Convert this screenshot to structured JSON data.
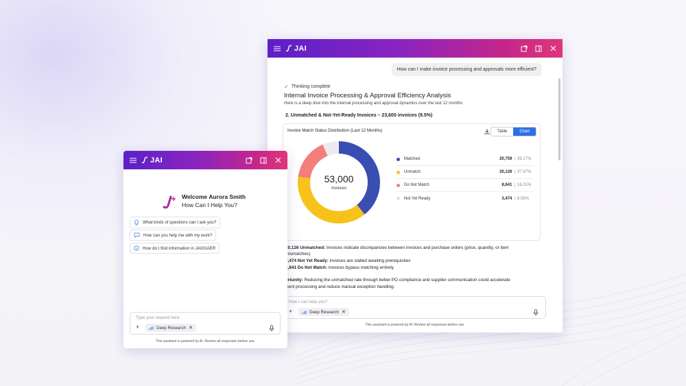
{
  "big_window": {
    "brand": "JAI",
    "user_message": "How can I make invoice processing and approvals more efficient?",
    "thinking_status": "Thinking complete",
    "title": "Internal Invoice Processing & Approval Efficiency Analysis",
    "subtitle": "Here is a deep dive into the internal processing and approval dynamics over the last 12 months",
    "section_heading": "2. Unmatched & Not-Yet-Ready Invoices – 23,600 invoices (9.5%)",
    "card": {
      "title": "Invoice Match Status Distribution (Last 12 Months)",
      "toggle_table": "Table",
      "toggle_chart": "Chart"
    },
    "bullets": [
      {
        "bold": "20,126 Unmatched:",
        "text": " Invoices indicate discrepancies between invoices and purchase orders (price, quantity, or item"
      },
      {
        "bold": "",
        "text": "mismatches)"
      },
      {
        "bold": "3,474 Not Yet Ready:",
        "text": " invoices are stalled awaiting prerequisites"
      },
      {
        "bold": "8,641 Do Not Match:",
        "text": " invoices bypass matching entirely"
      }
    ],
    "opportunity_label": "portunity:",
    "opportunity_text": " Reducing the unmatched rate through better PO compliance and supplier communication could accelerate",
    "opportunity_text2": "yment processing and reduce manual exception handling.",
    "input_placeholder": "How I can help you?",
    "chip_label": "Deep Research",
    "footer": "This assistant is powered by AI. Review all responses before use."
  },
  "small_window": {
    "brand": "JAI",
    "welcome_line1": "Welcome Aurora Smith",
    "welcome_line2": "How Can I Help You?",
    "suggestions": [
      {
        "icon": "lightbulb-icon",
        "label": "What kinds of questions can I ask you?"
      },
      {
        "icon": "chat-icon",
        "label": "How can you help me with my work?"
      },
      {
        "icon": "info-icon",
        "label": "How do I find information in JAGGAER"
      }
    ],
    "input_placeholder": "Type your request here",
    "chip_label": "Deep Research",
    "footer": "This assistant is powered by AI. Review all responses before use."
  },
  "colors": {
    "matched": "#3a4db0",
    "unmatch": "#f7c21a",
    "do_not_match": "#f47f7a",
    "not_yet_ready": "#ececef",
    "accent": "#2f6fe4"
  },
  "chart_data": {
    "type": "pie",
    "title": "Invoice Match Status Distribution (Last 12 Months)",
    "center_value": "53,000",
    "center_label": "Invoices",
    "categories": [
      "Matched",
      "Unmatch",
      "Do Not Match",
      "Not Yet Ready"
    ],
    "values": [
      20759,
      20126,
      8641,
      3474
    ],
    "value_labels": [
      "20,759",
      "20,126",
      "8,641",
      "3,474"
    ],
    "percent_labels": [
      "39.17%",
      "37.97%",
      "16.31%",
      "6.56%"
    ],
    "legend": "right"
  }
}
